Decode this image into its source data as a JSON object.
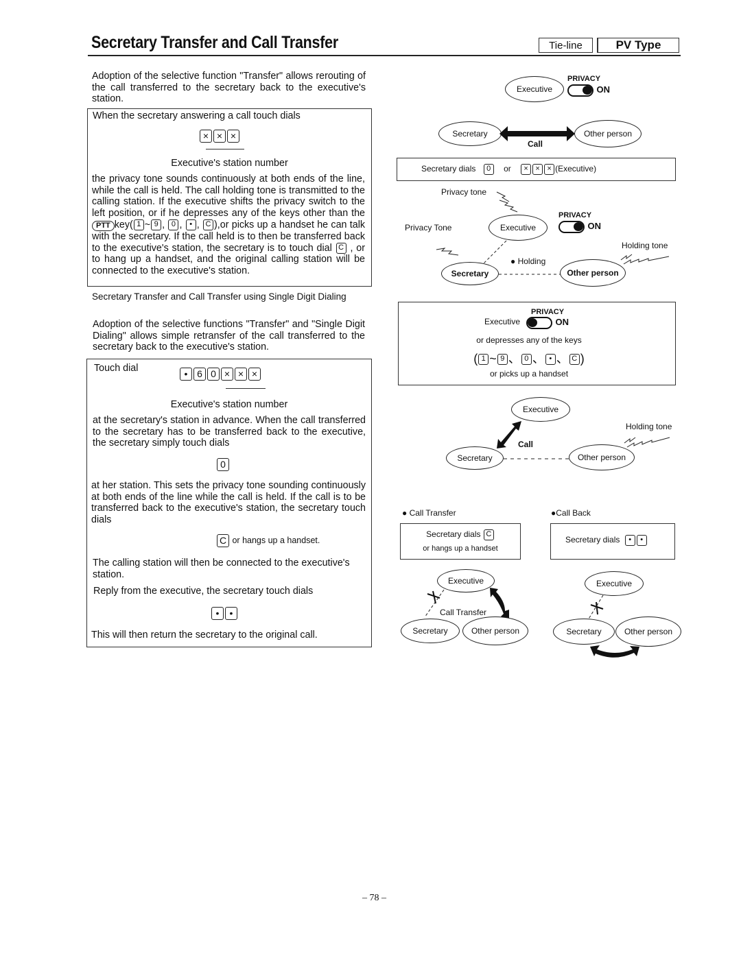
{
  "header": {
    "title": "Secretary Transfer and Call Transfer",
    "badge_tieline": "Tie-line",
    "badge_type": "PV Type"
  },
  "left": {
    "intro": "Adoption of the selective function \"Transfer\" allows rerouting of the call transferred to the secretary back to the executive's station.",
    "box1": {
      "lead": "When the secretary answering a call touch dials",
      "keys": [
        "×",
        "×",
        "×"
      ],
      "keys_caption": "Executive's station number",
      "body_part1": "the privacy tone sounds continuously at both ends of the line, while the call is held. The call holding tone is transmitted to the calling station. If the executive shifts the privacy switch to the left position, or if he depresses any of the keys other than the",
      "ptt_key": "PTT",
      "key_word": "key",
      "keys_list": [
        "1",
        "9",
        "0",
        "•",
        "C"
      ],
      "body_part2": ",or picks up a handset he can talk with the secretary. If the call held is to then be transferred back to the executive's station, the secretary is to touch dial",
      "key_c": "C",
      "body_part3": ", or to hang up a handset, and the original calling station will be connected to the executive's station."
    },
    "subheading": "Secretary Transfer and Call Transfer using Single Digit Dialing",
    "intro2": "Adoption of the selective functions \"Transfer\" and \"Single Digit Dialing\" allows simple retransfer of the call transferred to the secretary back to the executive's station.",
    "box2": {
      "touch_dial": "Touch dial",
      "keys": [
        "•",
        "6",
        "0",
        "×",
        "×",
        "×"
      ],
      "keys_caption": "Executive's station number",
      "para1": "at the secretary's station in advance. When the call transferred to the secretary has to be transferred back to the executive, the secretary simply touch dials",
      "key_0": "0",
      "para2": "at her station. This sets the privacy tone sounding continuously at both ends of the line while the call is held. If the call is to be transferred back to the executive's station, the secretary touch dials",
      "key_c": "C",
      "hangs_up": "or hangs up a handset.",
      "para3": "The calling station will then be connected to the executive's station.",
      "para4": "Reply from the executive, the secretary touch dials",
      "keys_dot": [
        "•",
        "•"
      ],
      "para5": "This will then return the secretary to the original call."
    }
  },
  "right": {
    "diag1": {
      "executive": "Executive",
      "privacy": "PRIVACY",
      "on": "ON",
      "secretary": "Secretary",
      "other": "Other person",
      "call": "Call"
    },
    "dialbox": {
      "secretary_dials": "Secretary dials",
      "key0": "0",
      "or": "or",
      "keys_x": [
        "×",
        "×",
        "×"
      ],
      "executive_suffix": "(Executive)"
    },
    "diag2": {
      "privacy_tone_top": "Privacy tone",
      "privacy_tone_left": "Privacy Tone",
      "executive": "Executive",
      "privacy": "PRIVACY",
      "on": "ON",
      "holding_tone": "Holding tone",
      "holding": "● Holding",
      "secretary": "Secretary",
      "other": "Other person"
    },
    "condbox": {
      "executive": "Executive",
      "privacy": "PRIVACY",
      "on": "ON",
      "line1": "or depresses any of the keys",
      "keys": [
        "1",
        "9",
        "0",
        "•",
        "C"
      ],
      "line3": "or picks up a handset"
    },
    "diag3": {
      "executive": "Executive",
      "holding_tone": "Holding tone",
      "call": "Call",
      "secretary": "Secretary",
      "other": "Other person"
    },
    "transfer": {
      "heading": "● Call Transfer",
      "box_line1": "Secretary dials",
      "key": "C",
      "box_line2": "or hangs up a handset",
      "executive": "Executive",
      "call_transfer": "Call Transfer",
      "secretary": "Secretary",
      "other": "Other person"
    },
    "callback": {
      "heading": "●Call Back",
      "box_line1": "Secretary dials",
      "keys": [
        "•",
        "•"
      ],
      "executive": "Executive",
      "secretary": "Secretary",
      "other": "Other person"
    }
  },
  "footer": {
    "page_number": "– 78 –"
  }
}
